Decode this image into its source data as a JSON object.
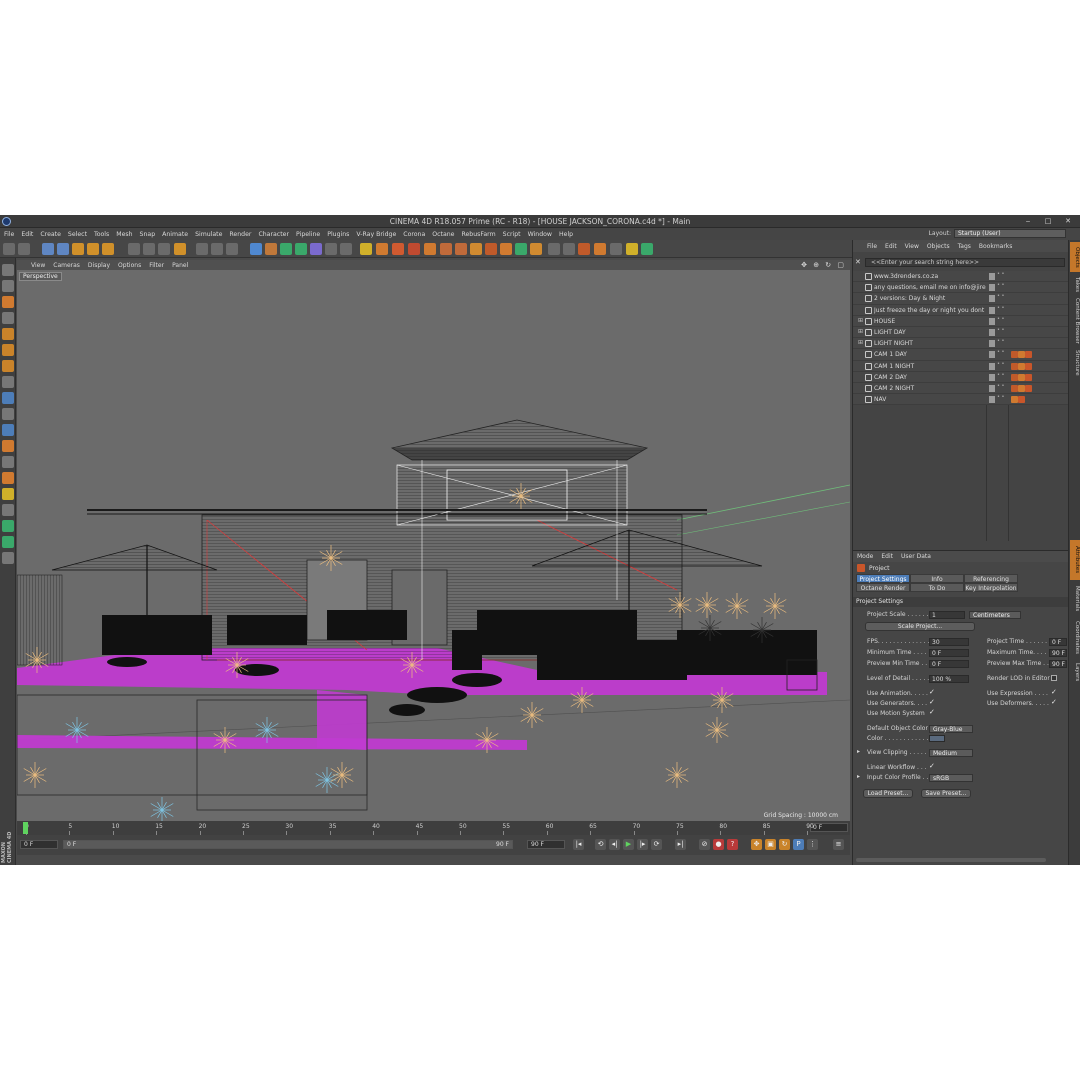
{
  "window": {
    "title": "CINEMA 4D R18.057 Prime (RC - R18) - [HOUSE JACKSON_CORONA.c4d *] - Main",
    "minimize": "‒",
    "maximize": "□",
    "close": "✕"
  },
  "menubar": {
    "items": [
      "File",
      "Edit",
      "Create",
      "Select",
      "Tools",
      "Mesh",
      "Snap",
      "Animate",
      "Simulate",
      "Render",
      "Character",
      "Pipeline",
      "Plugins",
      "V-Ray Bridge",
      "Corona",
      "Octane",
      "RebusFarm",
      "Script",
      "Window",
      "Help"
    ],
    "layout_label": "Layout:",
    "layout_value": "Startup (User)"
  },
  "viewport": {
    "menu": [
      "View",
      "Cameras",
      "Display",
      "Options",
      "Filter",
      "Panel"
    ],
    "nav_icons": "✥ ⊕ ↻ ▢",
    "label": "Perspective",
    "grid_spacing": "Grid Spacing : 10000 cm"
  },
  "timeline": {
    "ticks": [
      "0",
      "5",
      "10",
      "15",
      "20",
      "25",
      "30",
      "35",
      "40",
      "45",
      "50",
      "55",
      "60",
      "65",
      "70",
      "75",
      "80",
      "85",
      "90"
    ],
    "current_frame": "0 F"
  },
  "transport": {
    "start_field": "0 F",
    "min_field": "0 F",
    "max_field": "90 F",
    "end_field": "90 F",
    "maxon": "MAXON CINEMA 4D"
  },
  "object_manager": {
    "menu": [
      "File",
      "Edit",
      "View",
      "Objects",
      "Tags",
      "Bookmarks"
    ],
    "search_placeholder": "<<Enter your search string here>>",
    "objects": [
      {
        "name": "www.3drenders.co.za",
        "expand": "",
        "tags": []
      },
      {
        "name": "any questions, email me on info@jireh",
        "expand": "",
        "tags": []
      },
      {
        "name": "2 versions: Day & Night",
        "expand": "",
        "tags": []
      },
      {
        "name": "Just freeze the day or night you dont n",
        "expand": "",
        "tags": []
      },
      {
        "name": "HOUSE",
        "expand": "⊞",
        "tags": []
      },
      {
        "name": "LIGHT DAY",
        "expand": "⊞",
        "tags": []
      },
      {
        "name": "LIGHT NIGHT",
        "expand": "⊞",
        "tags": []
      },
      {
        "name": "CAM 1 DAY",
        "expand": "",
        "tags": [
          "#c05a2a",
          "#d07a30",
          "#c9562a"
        ]
      },
      {
        "name": "CAM 1 NIGHT",
        "expand": "",
        "tags": [
          "#c05a2a",
          "#d07a30",
          "#c9562a"
        ]
      },
      {
        "name": "CAM 2 DAY",
        "expand": "",
        "tags": [
          "#c05a2a",
          "#d07a30",
          "#c9562a"
        ]
      },
      {
        "name": "CAM 2 NIGHT",
        "expand": "",
        "tags": [
          "#c05a2a",
          "#d07a30",
          "#c9562a"
        ]
      },
      {
        "name": "NAV",
        "expand": "",
        "tags": [
          "#d07a30",
          "#c9562a"
        ]
      }
    ]
  },
  "attributes": {
    "menu": [
      "Mode",
      "Edit",
      "User Data"
    ],
    "header": "Project",
    "tabs": [
      {
        "label": "Project Settings",
        "active": true
      },
      {
        "label": "Info",
        "active": false
      },
      {
        "label": "Referencing",
        "active": false
      },
      {
        "label": "Octane Render",
        "active": false
      },
      {
        "label": "To Do",
        "active": false
      },
      {
        "label": "Key Interpolation",
        "active": false
      }
    ],
    "section": "Project Settings",
    "project_scale_label": "Project Scale . . . . . .",
    "project_scale_value": "1",
    "project_scale_unit": "Centimeters",
    "scale_project_button": "Scale Project...",
    "fps_label": "FPS. . . . . . . . . . . . . .",
    "fps_value": "30",
    "project_time_label": "Project Time . . . . . .",
    "project_time_value": "0 F",
    "min_time_label": "Minimum Time . . . . .",
    "min_time_value": "0 F",
    "max_time_label": "Maximum Time. . . . .",
    "max_time_value": "90 F",
    "preview_min_label": "Preview Min Time . .",
    "preview_min_value": "0 F",
    "preview_max_label": "Preview Max Time . .",
    "preview_max_value": "90 F",
    "lod_label": "Level of Detail . . . . .",
    "lod_value": "100 %",
    "render_lod_label": "Render LOD in Editor",
    "use_animation_label": "Use Animation. . . . .",
    "use_expression_label": "Use Expression . . . .",
    "use_generators_label": "Use Generators. . . .",
    "use_deformers_label": "Use Deformers. . . . .",
    "use_motion_label": "Use Motion System",
    "default_color_label": "Default Object Color",
    "default_color_value": "Gray-Blue",
    "color_label": "Color . . . . . . . . . . . .",
    "view_clipping_label": "View Clipping . . . . .",
    "view_clipping_value": "Medium",
    "linear_workflow_label": "Linear Workflow . . .",
    "input_profile_label": "Input Color Profile . .",
    "input_profile_value": "sRGB",
    "load_preset": "Load Preset...",
    "save_preset": "Save Preset...",
    "check": "✓",
    "expand_arrow": "▸"
  },
  "right_strip": {
    "tabs": [
      {
        "label": "Objects",
        "active": true
      },
      {
        "label": "Takes",
        "active": false
      },
      {
        "label": "Content Browser",
        "active": false
      },
      {
        "label": "Structure",
        "active": false
      },
      {
        "label": "Attributes",
        "active": true
      },
      {
        "label": "Materials",
        "active": false
      },
      {
        "label": "Coordinates",
        "active": false
      },
      {
        "label": "Layers",
        "active": false
      }
    ]
  },
  "colors": {
    "accent_blue": "#4d7db8",
    "accent_orange": "#c4772a",
    "floor_magenta": "#c03bd0"
  }
}
